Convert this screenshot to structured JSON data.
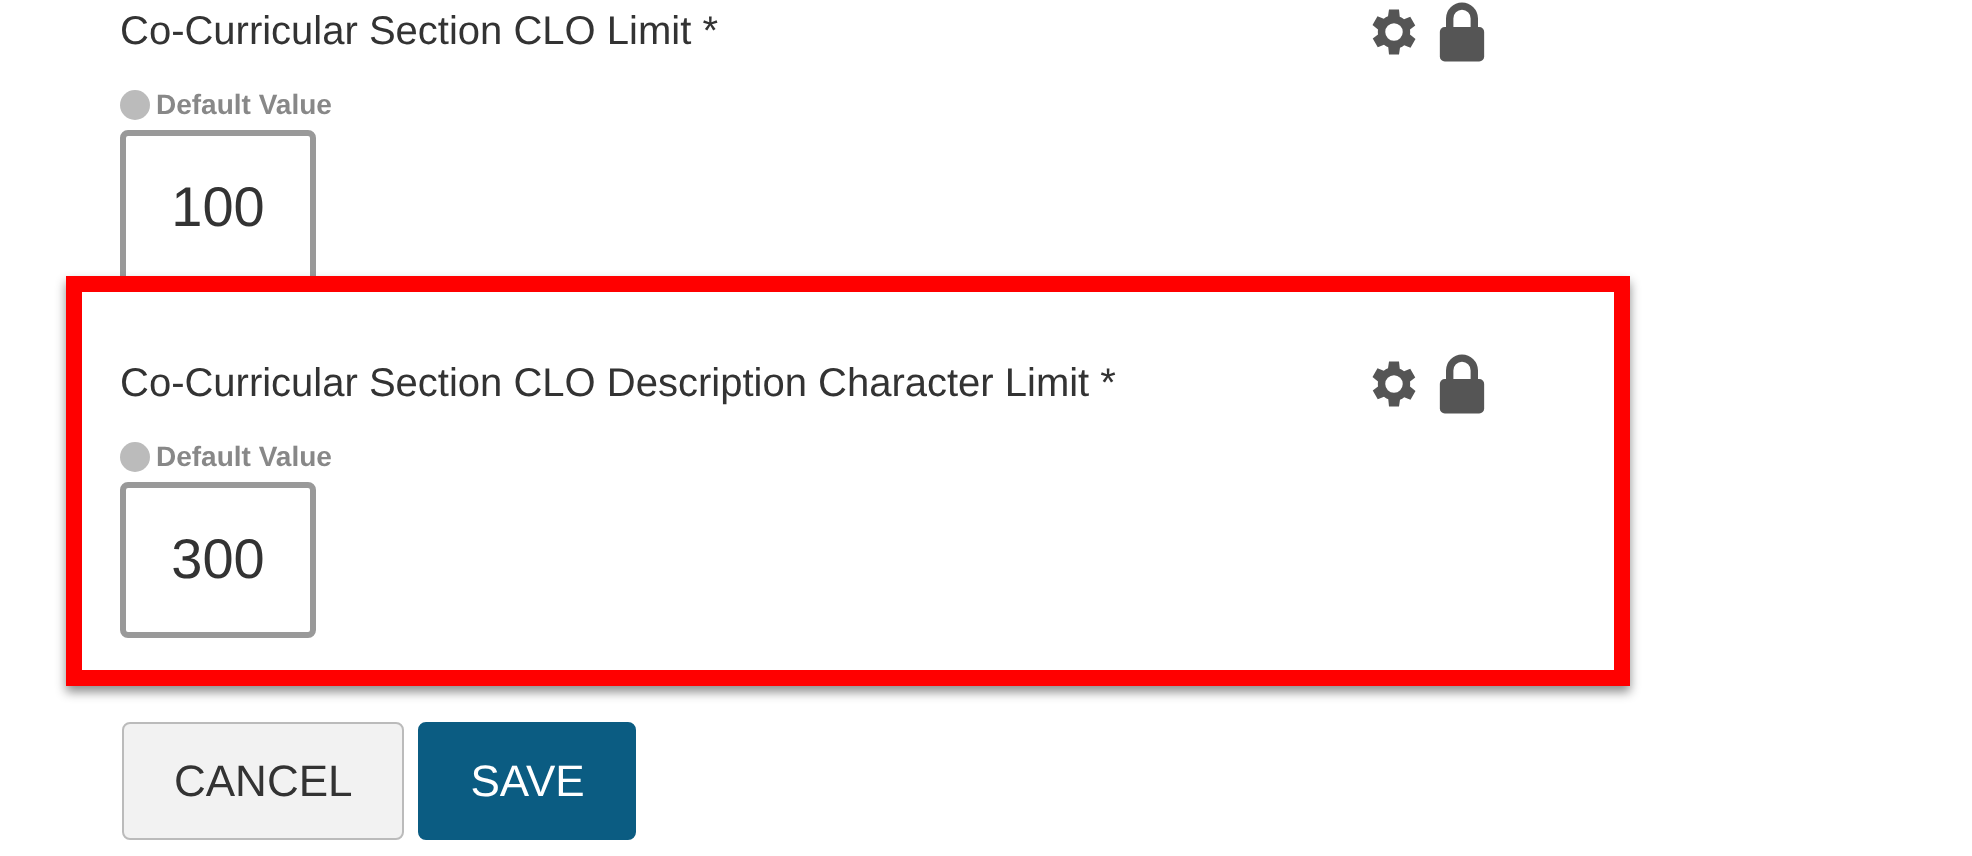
{
  "settings": [
    {
      "label": "Co-Curricular Section CLO Limit *",
      "default_label": "Default Value",
      "use_default": false,
      "value": "100",
      "highlighted": false
    },
    {
      "label": "Co-Curricular Section CLO Description Character Limit *",
      "default_label": "Default Value",
      "use_default": false,
      "value": "300",
      "highlighted": true
    }
  ],
  "buttons": [
    {
      "label": "CANCEL",
      "kind": "secondary"
    },
    {
      "label": "SAVE",
      "kind": "primary"
    }
  ]
}
